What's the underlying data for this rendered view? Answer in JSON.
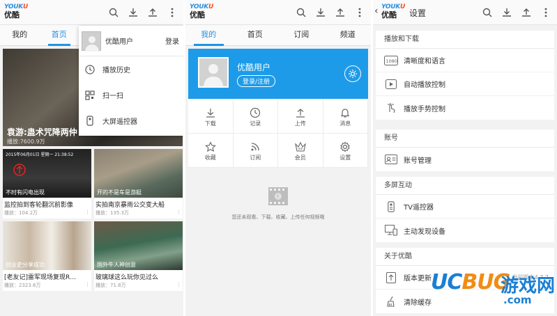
{
  "logo": {
    "en_1": "YOUK",
    "en_2": "U",
    "zh": "优酷"
  },
  "panel1": {
    "tabs": [
      {
        "label": "我的"
      },
      {
        "label": "首页"
      }
    ],
    "featured": {
      "caption": "袁游:蛊术咒降两仲",
      "count": "播放:7600.9万"
    },
    "cards": [
      {
        "title": "监控拍到客轮翻沉前影像",
        "overlay": "不时有闪电出现",
        "views": "播放：104.2万",
        "stamp": "2015年06月01日 星期一 21:38:52"
      },
      {
        "title": "实拍南京暴雨公交变大船",
        "overlay": "开的不是车是游艇",
        "views": "播放：135.3万"
      },
      {
        "title": "[老友记]雷军现场复现R…",
        "overlay": "创业史分享成功",
        "views": "播放：2323.6万"
      },
      {
        "title": "玻璃球这么玩你见过么",
        "overlay": "国外牛人神创意",
        "views": "播放：71.8万"
      }
    ],
    "dropdown": {
      "user": "优酷用户",
      "login": "登录",
      "items": [
        {
          "label": "播放历史"
        },
        {
          "label": "扫一扫"
        },
        {
          "label": "大屏遥控器"
        }
      ]
    }
  },
  "panel2": {
    "tabs": [
      {
        "label": "我的"
      },
      {
        "label": "首页"
      },
      {
        "label": "订阅"
      },
      {
        "label": "频道"
      }
    ],
    "user": "优酷用户",
    "login_button": "登录/注册",
    "menu": [
      {
        "label": "下载",
        "icon": "download-icon"
      },
      {
        "label": "记录",
        "icon": "clock-icon"
      },
      {
        "label": "上传",
        "icon": "upload-icon"
      },
      {
        "label": "消息",
        "icon": "bell-icon"
      },
      {
        "label": "收藏",
        "icon": "star-icon"
      },
      {
        "label": "订阅",
        "icon": "rss-icon"
      },
      {
        "label": "会员",
        "icon": "vip-icon"
      },
      {
        "label": "设置",
        "icon": "gear-icon"
      }
    ],
    "empty_text": "您还未观看、下载、收藏、上传任何视频哦"
  },
  "panel3": {
    "title": "设置",
    "sections": [
      {
        "header": "播放和下载",
        "items": [
          {
            "label": "清晰度和语言"
          },
          {
            "label": "自动播放控制"
          },
          {
            "label": "播放手势控制"
          }
        ]
      },
      {
        "header": "账号",
        "items": [
          {
            "label": "账号管理"
          }
        ]
      },
      {
        "header": "多屏互动",
        "items": [
          {
            "label": "TV遥控器"
          },
          {
            "label": "主动发现设备"
          }
        ]
      },
      {
        "header": "关于优酷",
        "items": [
          {
            "label": "版本更新",
            "right": "当前版本4.7.7"
          },
          {
            "label": "清除缓存"
          }
        ]
      }
    ]
  },
  "watermark": {
    "brand_1": "UC",
    "brand_2": "BUG",
    "zh": "游戏网",
    "domain": ".com"
  },
  "colors": {
    "accent": "#1e93e6",
    "profile_bg": "#1e9be8",
    "logo_red": "#ff4a1a"
  }
}
